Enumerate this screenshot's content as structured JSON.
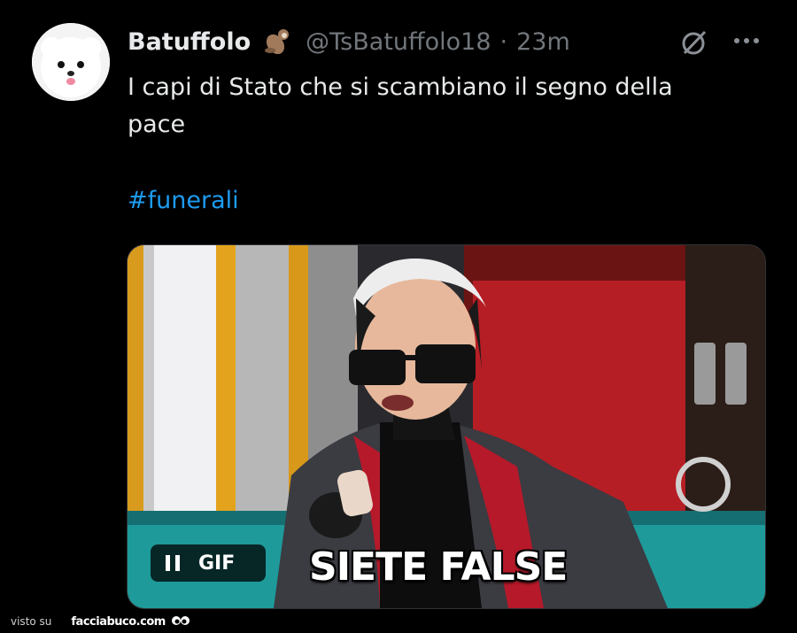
{
  "author": {
    "display_name": "Batuffolo",
    "emoji": "otter-emoji",
    "handle": "@TsBatuffolo18",
    "separator": "·",
    "time": "23m"
  },
  "tweet": {
    "text": "I capi di Stato che si scambiano il segno della\npace",
    "hashtag": "#funerali"
  },
  "media": {
    "caption": "SIETE FALSE",
    "badge_label": "GIF",
    "badge_icon": "pause-icon"
  },
  "footer": {
    "prefix": "visto su",
    "brand": "facciabuco.com",
    "brand_icon": "eyes-icon"
  },
  "colors": {
    "background": "#000000",
    "text": "#e7e9ea",
    "muted": "#71767b",
    "link": "#1d9bf0"
  }
}
